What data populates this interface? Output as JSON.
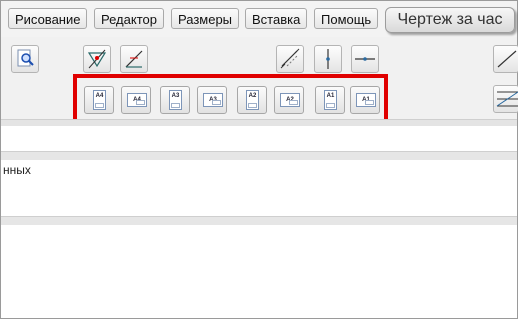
{
  "menu": {
    "items": [
      "Рисование",
      "Редактор",
      "Размеры",
      "Вставка",
      "Помощь"
    ],
    "special": "Чертеж за час"
  },
  "toolbar": {
    "tools": [
      {
        "name": "zoom-search-icon"
      },
      {
        "name": "draw-shape-icon"
      },
      {
        "name": "angle-line-icon"
      },
      {
        "name": "dimension-diagonal-icon"
      },
      {
        "name": "vertical-line-icon"
      },
      {
        "name": "horizontal-line-icon"
      },
      {
        "name": "line-tool-icon"
      },
      {
        "name": "hatch-tool-icon"
      }
    ],
    "formats": [
      {
        "label": "A4",
        "orientation": "portrait"
      },
      {
        "label": "A4",
        "orientation": "landscape"
      },
      {
        "label": "A3",
        "orientation": "portrait"
      },
      {
        "label": "A3",
        "orientation": "landscape"
      },
      {
        "label": "A2",
        "orientation": "portrait"
      },
      {
        "label": "A2",
        "orientation": "landscape"
      },
      {
        "label": "A1",
        "orientation": "portrait"
      },
      {
        "label": "A1",
        "orientation": "landscape"
      }
    ],
    "highlight_color": "#e00000"
  },
  "data_panel": {
    "text": "нных"
  }
}
